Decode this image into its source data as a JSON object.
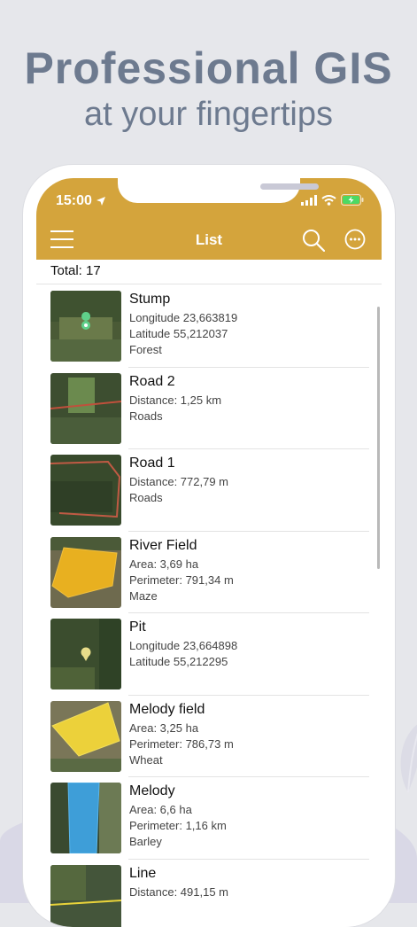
{
  "promo": {
    "title": "Professional GIS",
    "subtitle": "at your fingertips"
  },
  "status": {
    "time": "15:00"
  },
  "header": {
    "title": "List"
  },
  "summary": {
    "total": "Total: 17"
  },
  "items": [
    {
      "name": "Stump",
      "lines": [
        "Longitude 23,663819",
        "Latitude 55,212037",
        "Forest"
      ]
    },
    {
      "name": "Road 2",
      "lines": [
        "Distance: 1,25 km",
        "Roads",
        ""
      ]
    },
    {
      "name": "Road 1",
      "lines": [
        "Distance: 772,79 m",
        "Roads",
        ""
      ]
    },
    {
      "name": "River Field",
      "lines": [
        "Area: 3,69 ha",
        "Perimeter: 791,34 m",
        "Maze"
      ]
    },
    {
      "name": "Pit",
      "lines": [
        "Longitude 23,664898",
        "Latitude 55,212295",
        ""
      ]
    },
    {
      "name": "Melody field",
      "lines": [
        "Area: 3,25 ha",
        "Perimeter: 786,73 m",
        "Wheat"
      ]
    },
    {
      "name": "Melody",
      "lines": [
        "Area: 6,6 ha",
        "Perimeter: 1,16 km",
        "Barley"
      ]
    },
    {
      "name": "Line",
      "lines": [
        "Distance: 491,15 m",
        "",
        ""
      ]
    }
  ],
  "colors": {
    "accent": "#d4a43c",
    "promo_text": "#6d7a8f",
    "background": "#e6e7eb"
  }
}
